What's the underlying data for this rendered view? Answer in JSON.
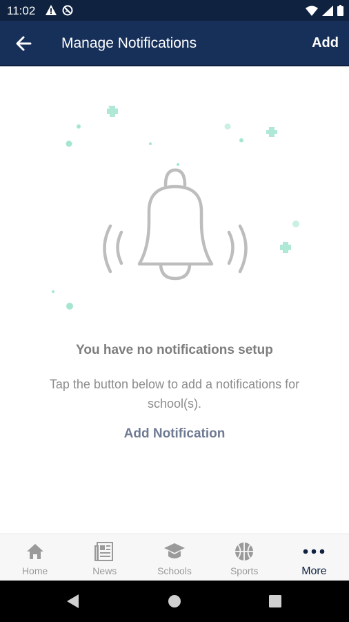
{
  "status_bar": {
    "time": "11:02"
  },
  "app_bar": {
    "title": "Manage Notifications",
    "action_label": "Add"
  },
  "empty_state": {
    "title": "You have no notifications setup",
    "description": "Tap the button below to add a notifications for school(s).",
    "link_label": "Add Notification"
  },
  "bottom_nav": {
    "items": [
      {
        "label": "Home",
        "icon": "home-icon"
      },
      {
        "label": "News",
        "icon": "news-icon"
      },
      {
        "label": "Schools",
        "icon": "graduation-cap-icon"
      },
      {
        "label": "Sports",
        "icon": "basketball-icon"
      },
      {
        "label": "More",
        "icon": "more-dots-icon"
      }
    ],
    "active": "More"
  },
  "colors": {
    "status_bar_bg": "#0f223f",
    "app_bar_bg": "#17305a",
    "bell_gray": "#bdbdbd",
    "sparkle_mint": "#9fe3cc",
    "link_color": "#6f7a93",
    "active_nav": "#0f223f"
  }
}
